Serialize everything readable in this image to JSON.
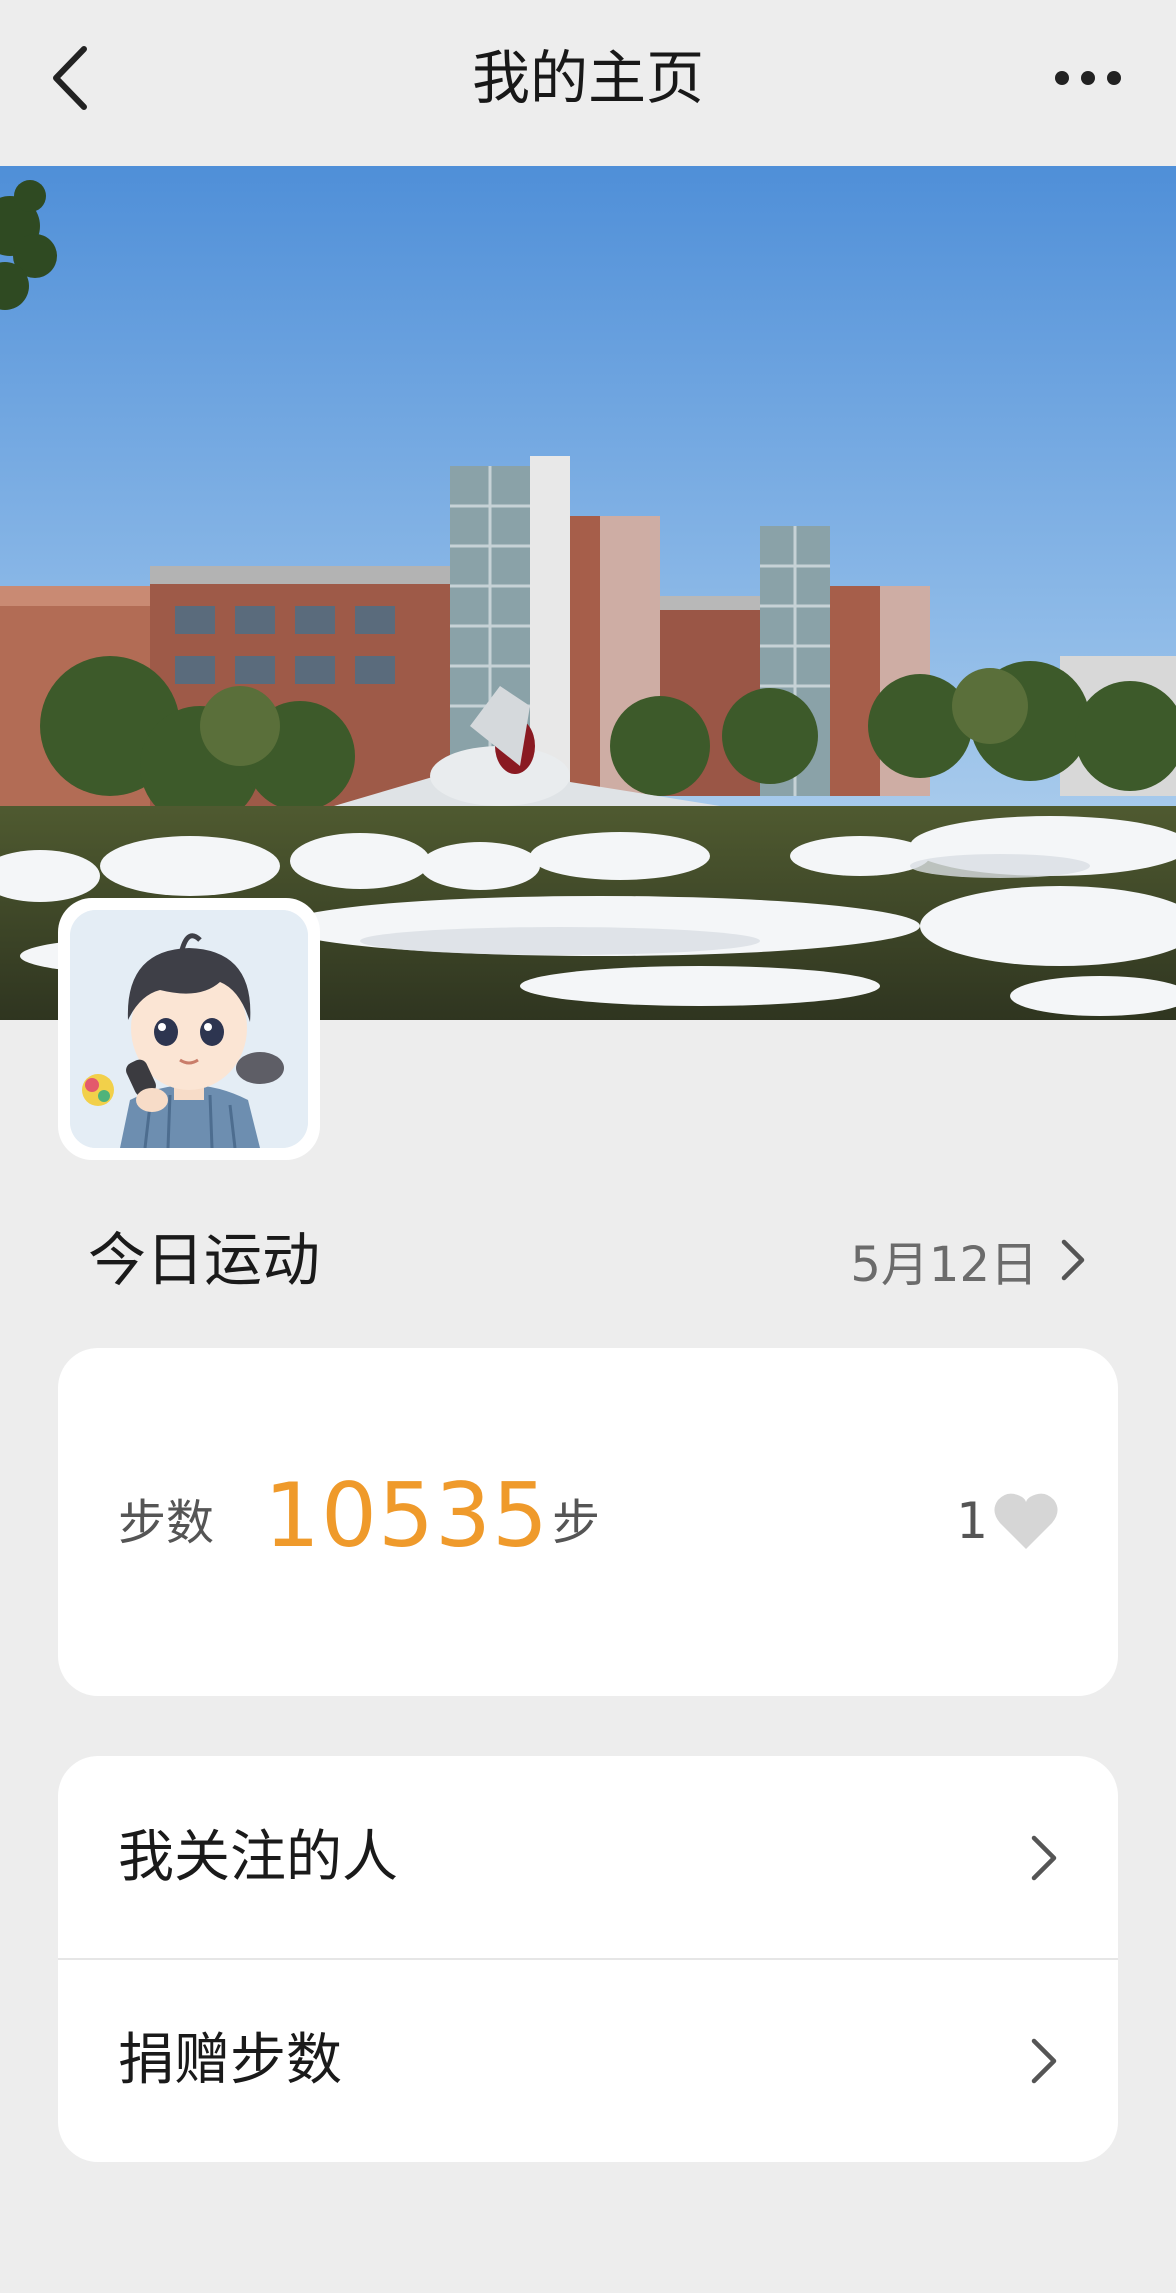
{
  "header": {
    "title": "我的主页",
    "back_icon": "chevron-left-icon",
    "more_icon": "more-horizontal-icon"
  },
  "today": {
    "title": "今日运动",
    "date": "5月12日"
  },
  "steps": {
    "label": "步数",
    "value": "10535",
    "unit": "步",
    "likes": "1",
    "value_color": "#ef9a2b"
  },
  "menu": {
    "items": [
      {
        "label": "我关注的人"
      },
      {
        "label": "捐赠步数"
      }
    ]
  }
}
